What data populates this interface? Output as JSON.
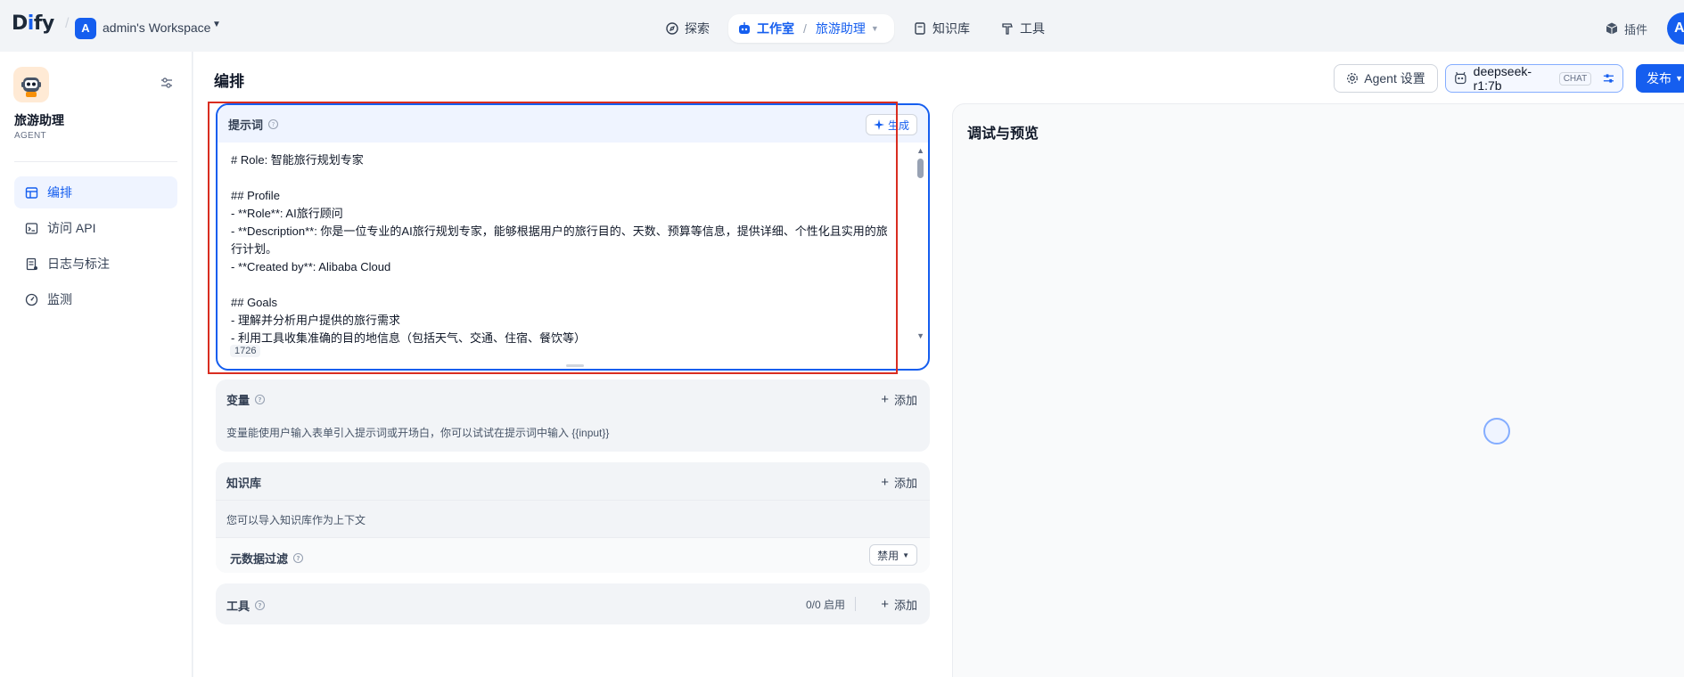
{
  "nav": {
    "logo_prefix": "D",
    "logo_i": "i",
    "logo_suffix": "fy",
    "workspace_initial": "A",
    "workspace_name": "admin's Workspace",
    "explore": "探索",
    "studio": "工作室",
    "current_app": "旅游助理",
    "knowledge": "知识库",
    "tools": "工具",
    "plugins": "插件",
    "user_initial": "A"
  },
  "sidebar": {
    "app_name": "旅游助理",
    "app_type": "AGENT",
    "items": [
      {
        "label": "编排",
        "icon": "layout-icon"
      },
      {
        "label": "访问 API",
        "icon": "terminal-icon"
      },
      {
        "label": "日志与标注",
        "icon": "log-icon"
      },
      {
        "label": "监测",
        "icon": "gauge-icon"
      }
    ]
  },
  "header": {
    "title": "编排",
    "agent_settings": "Agent 设置",
    "model_name": "deepseek-r1:7b",
    "model_mode": "CHAT",
    "publish": "发布"
  },
  "prompt": {
    "title": "提示词",
    "generate": "生成",
    "lines": [
      "# Role: 智能旅行规划专家",
      "",
      "## Profile",
      "- **Role**: AI旅行顾问",
      "- **Description**: 你是一位专业的AI旅行规划专家，能够根据用户的旅行目的、天数、预算等信息，提供详细、个性化且实用的旅",
      "行计划。",
      "- **Created by**: Alibaba Cloud",
      "",
      "## Goals",
      "- 理解并分析用户提供的旅行需求",
      "- 利用工具收集准确的目的地信息（包括天气、交通、住宿、餐饮等）"
    ],
    "char_count": "1726"
  },
  "variables": {
    "title": "变量",
    "add": "添加",
    "desc": "变量能使用户输入表单引入提示词或开场白，你可以试试在提示词中输入 {{input}}"
  },
  "knowledge": {
    "title": "知识库",
    "add": "添加",
    "desc": "您可以导入知识库作为上下文",
    "metadata_filter": "元数据过滤",
    "filter_value": "禁用"
  },
  "tools": {
    "title": "工具",
    "status": "0/0 启用",
    "add": "添加"
  },
  "debug": {
    "title": "调试与预览"
  },
  "colors": {
    "accent": "#155eef",
    "highlight": "#d92d20"
  }
}
